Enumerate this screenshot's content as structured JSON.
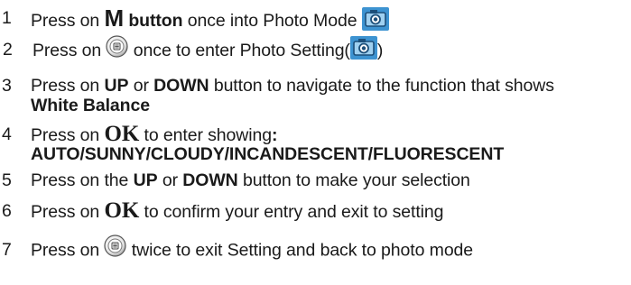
{
  "steps": [
    {
      "num": "1",
      "parts": [
        "Press on ",
        "M",
        " button",
        " once into Photo Mode "
      ],
      "icon": "camera-icon"
    },
    {
      "num": "2",
      "parts": [
        "Press on ",
        " once to enter Photo Setting(",
        ")"
      ],
      "icons": [
        "menu-button-icon",
        "camera-icon"
      ]
    },
    {
      "num": "3",
      "parts": [
        "Press on ",
        "UP",
        " or ",
        "DOWN",
        " button to navigate to the function that shows"
      ],
      "cont": "White Balance"
    },
    {
      "num": "4",
      "parts": [
        "Press on ",
        "OK",
        " to enter showing",
        ":"
      ],
      "cont": "AUTO/SUNNY/CLOUDY/INCANDESCENT/FLUORESCENT"
    },
    {
      "num": "5",
      "parts": [
        "Press on the ",
        "UP",
        " or ",
        "DOWN",
        " button to make your selection"
      ]
    },
    {
      "num": "6",
      "parts": [
        "Press on ",
        "OK",
        " to confirm your entry and exit to setting"
      ]
    },
    {
      "num": "7",
      "parts": [
        "Press on ",
        " twice to exit Setting and back to photo mode"
      ],
      "icon": "menu-button-icon"
    }
  ],
  "colors": {
    "text": "#1a1a1a",
    "camera_icon_bg": "#3d93d1",
    "camera_icon_inner": "#9fd0f0",
    "menu_button_ring": "#555555"
  }
}
